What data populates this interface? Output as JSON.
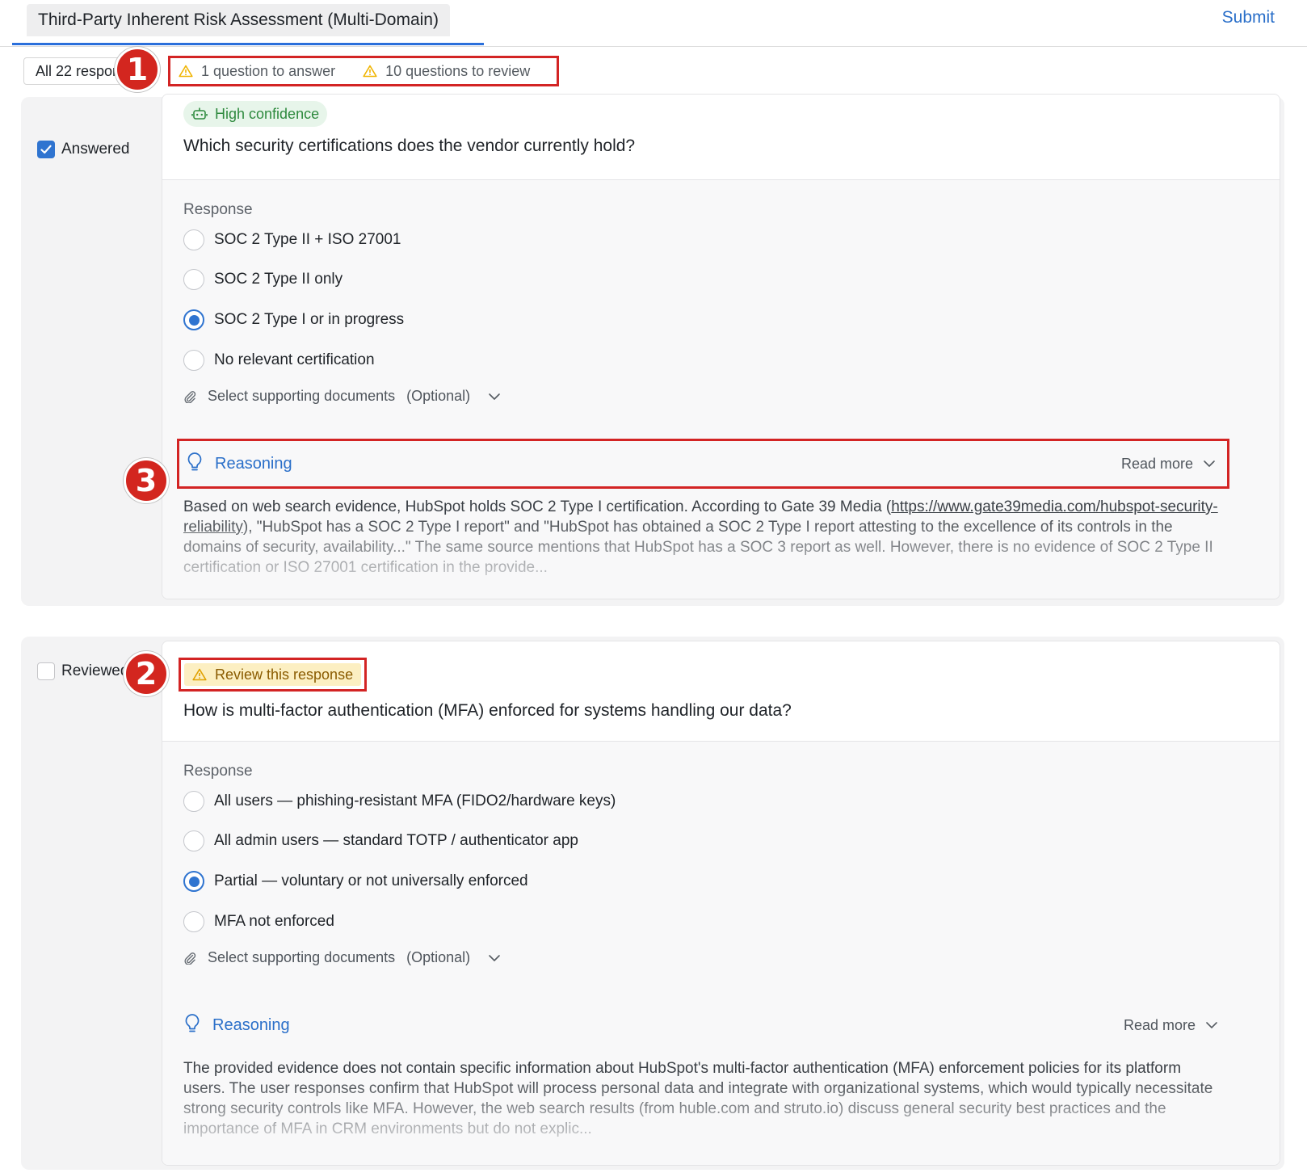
{
  "header": {
    "tab_title": "Third-Party Inherent Risk Assessment (Multi-Domain)",
    "submit_label": "Submit"
  },
  "filter": {
    "selected": "All 22 responses"
  },
  "status": {
    "to_answer": "1 question to answer",
    "to_review": "10 questions to review"
  },
  "badges": [
    "1",
    "2",
    "3"
  ],
  "colors": {
    "accent": "#2f74d0",
    "highlight_red": "#d32424",
    "warning": "#f0b400",
    "success": "#2e8a3e"
  },
  "questions": [
    {
      "side_status": "Answered",
      "side_checked": true,
      "tag": "High confidence",
      "tag_icon": "robot-icon",
      "question": "Which security certifications does the vendor currently hold?",
      "response_label": "Response",
      "options": [
        "SOC 2 Type II + ISO 27001",
        "SOC 2 Type II only",
        "SOC 2 Type I or in progress",
        "No relevant certification"
      ],
      "selected_index": 2,
      "docs_label": "Select supporting documents",
      "docs_optional": "(Optional)",
      "reasoning_title": "Reasoning",
      "read_more": "Read more",
      "reasoning_before": "Based on web search evidence, HubSpot holds SOC 2 Type I certification. According to Gate 39 Media (",
      "reasoning_link": "https://www.gate39media.com/hubspot-security-reliability",
      "reasoning_after": "), \"HubSpot has a SOC 2 Type I report\" and \"HubSpot has obtained a SOC 2 Type I report attesting to the excellence of its controls in the domains of security, availability...\" The same source mentions that HubSpot has a SOC 3 report as well. However, there is no evidence of SOC 2 Type II certification or ISO 27001 certification in the provide..."
    },
    {
      "side_status": "Reviewed",
      "side_checked": false,
      "tag": "Review this response",
      "tag_icon": "warning-icon",
      "question": "How is multi-factor authentication (MFA) enforced for systems handling our data?",
      "response_label": "Response",
      "options": [
        "All users — phishing-resistant MFA (FIDO2/hardware keys)",
        "All admin users — standard TOTP / authenticator app",
        "Partial — voluntary or not universally enforced",
        "MFA not enforced"
      ],
      "selected_index": 2,
      "docs_label": "Select supporting documents",
      "docs_optional": "(Optional)",
      "reasoning_title": "Reasoning",
      "read_more": "Read more",
      "reasoning_text": "The provided evidence does not contain specific information about HubSpot's multi-factor authentication (MFA) enforcement policies for its platform users. The user responses confirm that HubSpot will process personal data and integrate with organizational systems, which would typically necessitate strong security controls like MFA. However, the web search results (from huble.com and struto.io) discuss general security best practices and the importance of MFA in CRM environments but do not explic..."
    }
  ]
}
